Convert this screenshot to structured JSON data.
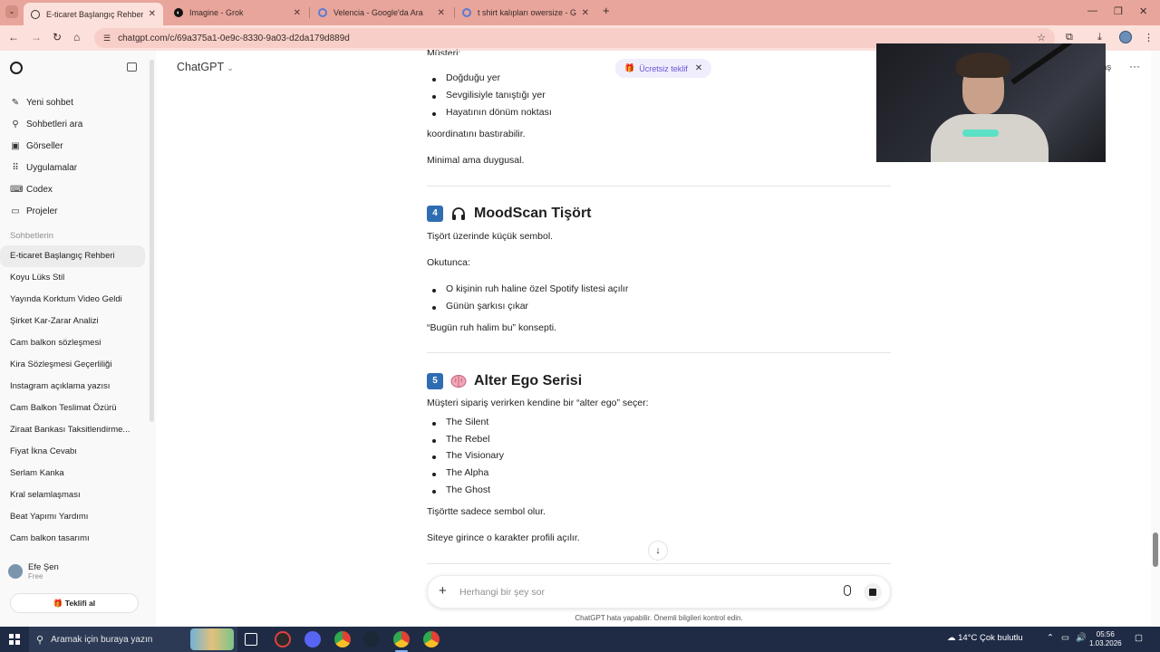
{
  "browser": {
    "tabs": [
      {
        "label": "E-ticaret Başlangıç Rehberi",
        "active": true
      },
      {
        "label": "Imagine - Grok",
        "active": false
      },
      {
        "label": "Velencia - Google'da Ara",
        "active": false
      },
      {
        "label": "t shirt kalıpları owersize - Goog",
        "active": false
      }
    ],
    "url": "chatgpt.com/c/69a375a1-0e9c-8330-9a03-d2da179d889d",
    "accent": "#e8a59b"
  },
  "sidebar": {
    "nav": [
      {
        "label": "Yeni sohbet",
        "icon": "edit-icon"
      },
      {
        "label": "Sohbetleri ara",
        "icon": "search-icon"
      },
      {
        "label": "Görseller",
        "icon": "images-icon"
      },
      {
        "label": "Uygulamalar",
        "icon": "apps-icon"
      },
      {
        "label": "Codex",
        "icon": "codex-icon"
      },
      {
        "label": "Projeler",
        "icon": "folder-icon"
      }
    ],
    "section_label": "Sohbetlerin",
    "chats": [
      "E-ticaret Başlangıç Rehberi",
      "Koyu Lüks Stil",
      "Yayında Korktum Video Geldi",
      "Şirket Kar-Zarar Analizi",
      "Cam balkon sözleşmesi",
      "Kira Sözleşmesi Geçerliliği",
      "Instagram açıklama yazısı",
      "Cam Balkon Teslimat Özürü",
      "Ziraat Bankası Taksitlendirme...",
      "Fiyat İkna Cevabı",
      "Serlam Kanka",
      "Kral selamlaşması",
      "Beat Yapımı Yardımı",
      "Cam balkon tasarımı"
    ],
    "user": {
      "name": "Efe Şen",
      "plan": "Free"
    },
    "upgrade_label": "Teklifi al"
  },
  "header": {
    "model": "ChatGPT",
    "free_offer": "Ücretsiz teklif",
    "top_right": "laş"
  },
  "content": {
    "partial_top": "Müşteri:",
    "list1": [
      "Doğduğu yer",
      "Sevgilisiyle tanıştığı yer",
      "Hayatının dönüm noktası"
    ],
    "p1": "koordinatını bastırabilir.",
    "p2": "Minimal ama duygusal.",
    "section4": {
      "number": "4",
      "title": "MoodScan Tişört",
      "p1": "Tişört üzerinde küçük sembol.",
      "p2": "Okutunca:",
      "list": [
        "O kişinin ruh haline özel Spotify listesi açılır",
        "Günün şarkısı çıkar"
      ],
      "p3": "“Bugün ruh halim bu” konsepti."
    },
    "section5": {
      "number": "5",
      "title": "Alter Ego Serisi",
      "p1": "Müşteri sipariş verirken kendine bir “alter ego” seçer:",
      "list": [
        "The Silent",
        "The Rebel",
        "The Visionary",
        "The Alpha",
        "The Ghost"
      ],
      "p2": "Tişörtte sadece sembol olur.",
      "p3": "Siteye girince o karakter profili açılır."
    }
  },
  "composer": {
    "placeholder": "Herhangi bir şey sor",
    "disclaimer": "ChatGPT hata yapabilir. Önemli bilgileri kontrol edin."
  },
  "taskbar": {
    "search_placeholder": "Aramak için buraya yazın",
    "weather": "14°C  Çok bulutlu",
    "time": "05:56",
    "date": "1.03.2026"
  }
}
